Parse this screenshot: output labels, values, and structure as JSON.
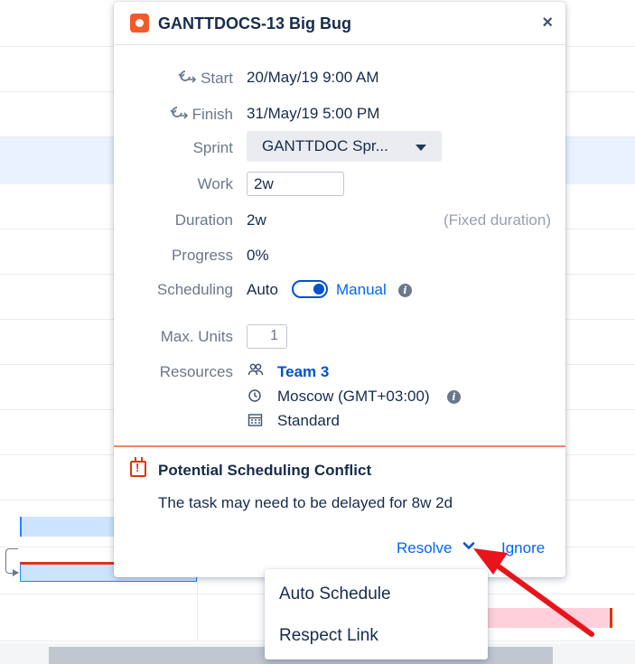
{
  "card": {
    "issue_key_title": "GANTTDOCS-13 Big Bug",
    "close_label": "×"
  },
  "fields": {
    "start_label": "Start",
    "start_value": "20/May/19 9:00 AM",
    "finish_label": "Finish",
    "finish_value": "31/May/19 5:00 PM",
    "sprint_label": "Sprint",
    "sprint_value": "GANTTDOC Spr...",
    "work_label": "Work",
    "work_value": "2w",
    "duration_label": "Duration",
    "duration_value": "2w",
    "duration_note": "(Fixed duration)",
    "progress_label": "Progress",
    "progress_value": "0%",
    "scheduling_label": "Scheduling",
    "scheduling_auto": "Auto",
    "scheduling_manual": "Manual",
    "scheduling_mode": "Manual",
    "max_units_label": "Max. Units",
    "max_units_value": "1",
    "resources_label": "Resources",
    "resource_team": "Team 3",
    "resource_timezone": "Moscow (GMT+03:00)",
    "resource_calendar": "Standard"
  },
  "conflict": {
    "title": "Potential Scheduling Conflict",
    "message": "The task may need to be delayed for 8w 2d",
    "resolve_label": "Resolve",
    "ignore_label": "Ignore"
  },
  "dropdown": {
    "items": [
      "Auto Schedule",
      "Respect Link"
    ]
  },
  "icons": {
    "issue": "bug-issue-icon",
    "schedule": "auto-schedule-icon",
    "team": "team-icon",
    "clock": "clock-icon",
    "calendar": "calendar-icon",
    "info": "info-icon",
    "conflict": "calendar-alert-icon",
    "chevron": "chevron-down-icon"
  },
  "colors": {
    "accent": "#0052cc",
    "link": "#0065ff",
    "issue_icon": "#f15b2a",
    "conflict": "#de350b",
    "annotation_arrow": "#e8131b"
  }
}
